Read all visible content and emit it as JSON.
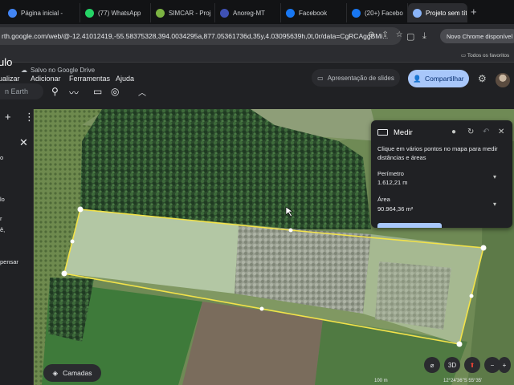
{
  "tabs": [
    {
      "title": "Página inicial -",
      "color": "#4285f4"
    },
    {
      "title": "(77) WhatsApp",
      "color": "#25d366"
    },
    {
      "title": "SIMCAR - Proj",
      "color": "#7cb342"
    },
    {
      "title": "Anoreg-MT",
      "color": "#3f51b5"
    },
    {
      "title": "Facebook",
      "color": "#1877f2"
    },
    {
      "title": "(20+) Facebo",
      "color": "#1877f2"
    },
    {
      "title": "Projeto sem tít",
      "color": "#8ab4f8"
    }
  ],
  "address": {
    "url": "rth.google.com/web/@-12.41012419,-55.58375328,394.0034295a,877.05361736d,35y,4.03095639h,0t,0r/data=CgRCAggBMi..."
  },
  "browser": {
    "chrome_update": "Novo Chrome disponível",
    "all_bookmarks": "Todos os favoritos"
  },
  "app": {
    "project_name": "ulo",
    "saved_status": "Salvo no Google Drive",
    "menu": [
      "ualizar",
      "Adicionar",
      "Ferramentas",
      "Ajuda"
    ],
    "slides_button": "Apresentação de slides",
    "share_button": "Compartilhar",
    "search_placeholder": "n Earth"
  },
  "left_panel": {
    "lines": [
      "o",
      "lo",
      "r",
      "ê,",
      "pensar"
    ]
  },
  "measure": {
    "title": "Medir",
    "description": "Clique em vários pontos no mapa para medir distâncias e áreas",
    "perimeter_label": "Perímetro",
    "perimeter_value": "1.612,21 m",
    "area_label": "Área",
    "area_value": "90.964,36 m²"
  },
  "map": {
    "layers_button": "Camadas",
    "view_3d": "3D",
    "scale": "100 m",
    "coords": "12°24'36\"S 55°35'"
  },
  "colors": {
    "measure_outline": "#f2e24a",
    "accent": "#a8c7fa"
  }
}
